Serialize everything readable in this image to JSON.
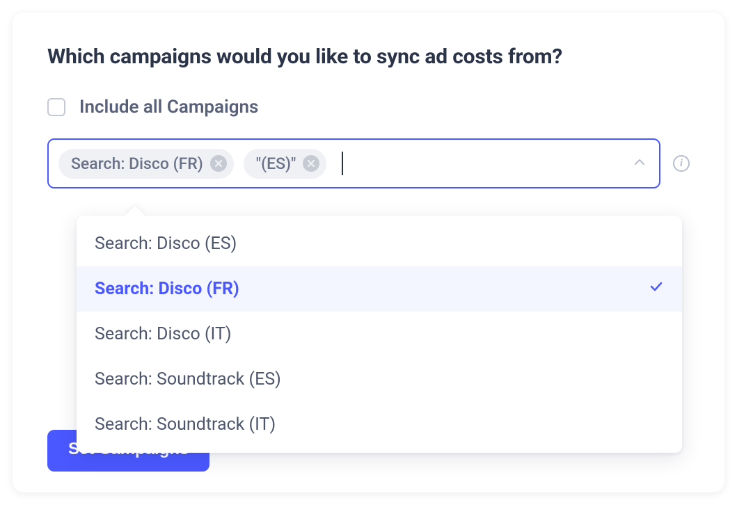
{
  "title": "Which campaigns would you like to sync ad costs from?",
  "include_all": {
    "label": "Include all Campaigns",
    "checked": false
  },
  "selector": {
    "tags": [
      {
        "label": "Search: Disco (FR)"
      },
      {
        "label": "\"(ES)\""
      }
    ],
    "input_value": ""
  },
  "dropdown": {
    "options": [
      {
        "label": "Search: Disco (ES)",
        "selected": false
      },
      {
        "label": "Search: Disco (FR)",
        "selected": true
      },
      {
        "label": "Search: Disco (IT)",
        "selected": false
      },
      {
        "label": "Search: Soundtrack (ES)",
        "selected": false
      },
      {
        "label": "Search: Soundtrack (IT)",
        "selected": false
      }
    ]
  },
  "button": {
    "label": "Set Campaigns"
  },
  "info": {
    "glyph": "i"
  },
  "colors": {
    "accent": "#4a58ff",
    "text_dark": "#2b3448",
    "text_muted": "#59617a"
  }
}
